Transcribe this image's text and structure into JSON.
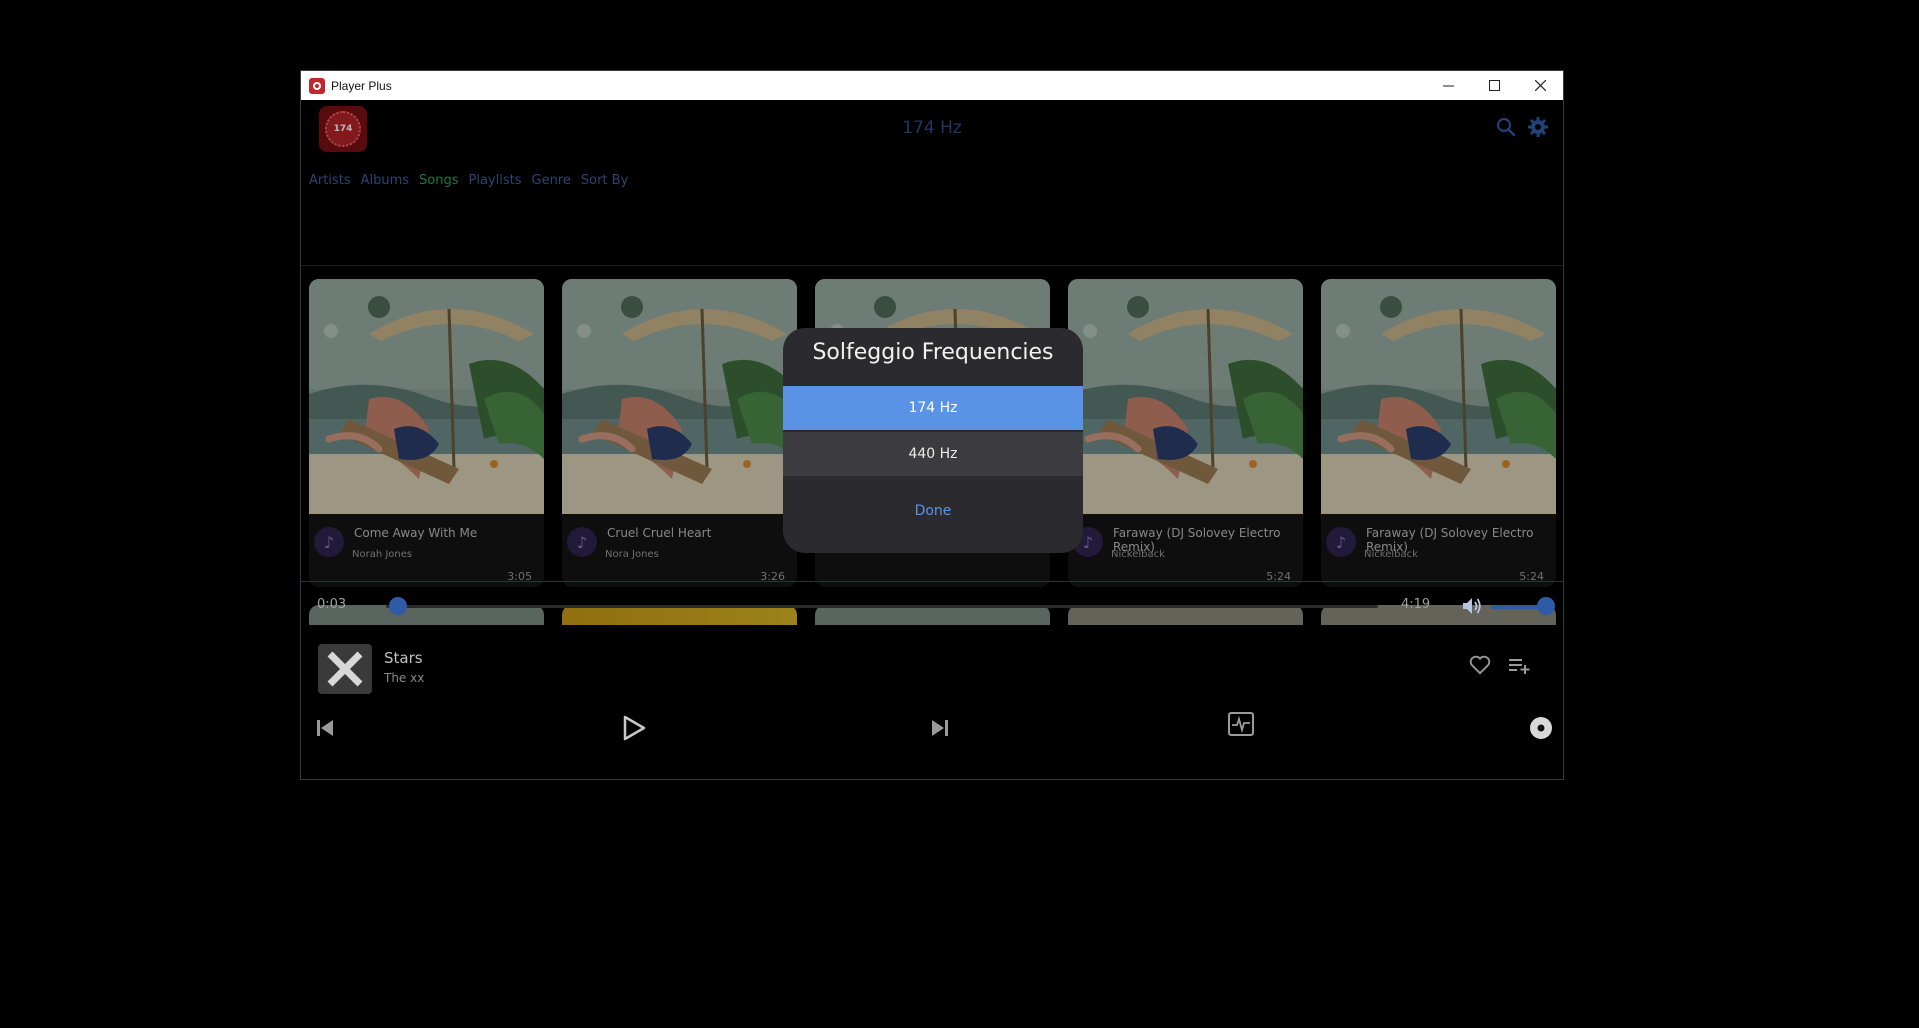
{
  "window": {
    "title": "Player Plus"
  },
  "header": {
    "logo_text": "174",
    "frequency_title": "174 Hz",
    "nav": [
      "Artists",
      "Albums",
      "Songs",
      "Playlists",
      "Genre",
      "Sort By"
    ],
    "active_nav": "Songs"
  },
  "songs": [
    {
      "title": "Come Away With Me",
      "artist": "Norah Jones",
      "duration": "3:05"
    },
    {
      "title": "Cruel Cruel Heart",
      "artist": "Nora Jones",
      "duration": "3:26"
    },
    {
      "title": "",
      "artist": "",
      "duration": ""
    },
    {
      "title": "Faraway (DJ Solovey Electro Remix)",
      "artist": "Nickelback",
      "duration": "5:24"
    },
    {
      "title": "Faraway (DJ Solovey Electro Remix)",
      "artist": "Nickelback",
      "duration": "5:24"
    }
  ],
  "player": {
    "current_time": "0:03",
    "total_time": "4:19",
    "progress": 0.012,
    "volume": 1.0,
    "now_playing_title": "Stars",
    "now_playing_artist": "The xx"
  },
  "dialog": {
    "title": "Solfeggio Frequencies",
    "options": [
      "174 Hz",
      "440 Hz"
    ],
    "selected": "174 Hz",
    "done_label": "Done"
  },
  "colors": {
    "accent": "#2f5aa6",
    "dialog_selected": "#5a93e6",
    "active_tab": "#2aa55a",
    "nav_text": "#3d5ea0"
  }
}
